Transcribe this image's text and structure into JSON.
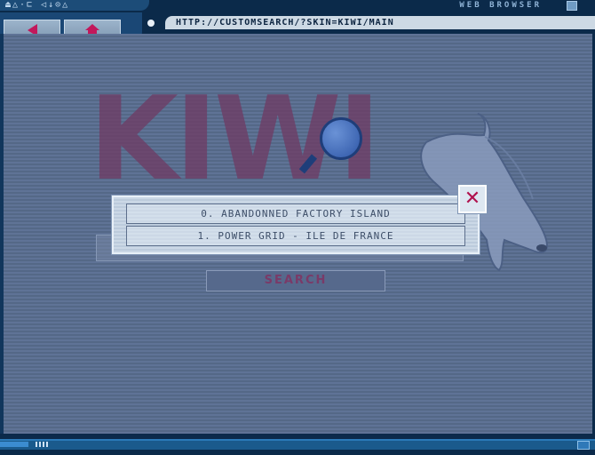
{
  "window": {
    "title": "WEB BROWSER"
  },
  "toolbar": {
    "top_icons": "⏏△·⊏ ◁↓⊙△",
    "back_icon": "arrow-left-icon",
    "home_icon": "home-icon"
  },
  "address_bar": {
    "url": "HTTP://CUSTOMSEARCH/?SKIN=KIWI/MAIN"
  },
  "page": {
    "logo_text": "KIWI",
    "search_button_label": "SEARCH",
    "search_value": ""
  },
  "suggestions": {
    "items": [
      "0. ABANDONNED FACTORY ISLAND",
      "1. POWER GRID - ILE DE FRANCE"
    ],
    "close_label": "✕"
  },
  "colors": {
    "accent": "#c2185b",
    "chrome": "#0b2a4a",
    "content_bg": "#5b6f92",
    "logo": "#6f3a63"
  }
}
